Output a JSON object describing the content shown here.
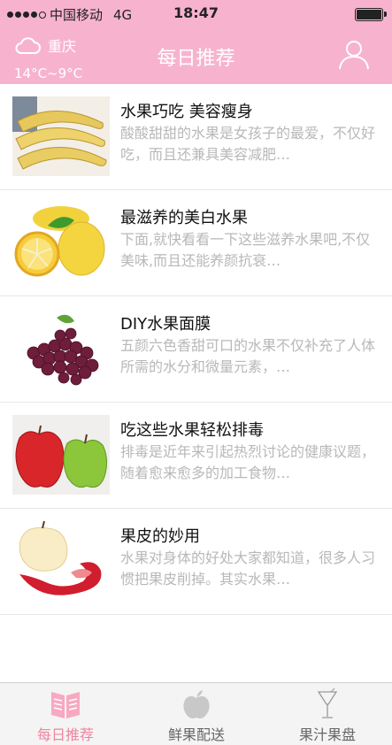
{
  "status_bar": {
    "carrier": "中国移动",
    "network": "4G",
    "time": "18:47"
  },
  "header": {
    "city": "重庆",
    "temperature": "14°C~9°C",
    "title": "每日推荐",
    "weather_icon": "cloud-icon",
    "user_icon": "user-icon"
  },
  "articles": [
    {
      "title": "水果巧吃 美容瘦身",
      "desc": "酸酸甜甜的水果是女孩子的最爱，不仅好吃，而且还兼具美容减肥…",
      "image": "bananas-image"
    },
    {
      "title": "最滋养的美白水果",
      "desc": "下面,就快看看一下这些滋养水果吧,不仅美味,而且还能养颜抗衰…",
      "image": "lemons-image"
    },
    {
      "title": "DIY水果面膜",
      "desc": "五颜六色香甜可口的水果不仅补充了人体所需的水分和微量元素，…",
      "image": "grapes-image"
    },
    {
      "title": "吃这些水果轻松排毒",
      "desc": "排毒是近年来引起热烈讨论的健康议题，随着愈来愈多的加工食物…",
      "image": "apples-image"
    },
    {
      "title": "果皮的妙用",
      "desc": "水果对身体的好处大家都知道，很多人习惯把果皮削掉。其实水果…",
      "image": "peeled-apple-image"
    }
  ],
  "tabs": [
    {
      "label": "每日推荐",
      "icon": "book-icon",
      "active": true
    },
    {
      "label": "鲜果配送",
      "icon": "apple-icon",
      "active": false
    },
    {
      "label": "果汁果盘",
      "icon": "glass-icon",
      "active": false
    }
  ],
  "colors": {
    "accent": "#f7b3ce",
    "active_tab": "#f0849f"
  }
}
